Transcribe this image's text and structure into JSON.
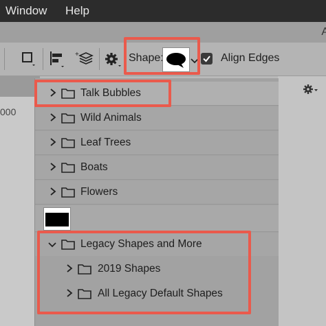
{
  "menubar": {
    "items": [
      "Window",
      "Help"
    ]
  },
  "strip_char": "A",
  "options_bar": {
    "shape_label": "Shape:",
    "align_edges_label": "Align Edges",
    "align_edges_checked": true
  },
  "ruler_label": "000",
  "dropdown": {
    "groups": [
      {
        "label": "Talk Bubbles"
      },
      {
        "label": "Wild Animals"
      },
      {
        "label": "Leaf Trees"
      },
      {
        "label": "Boats"
      },
      {
        "label": "Flowers"
      }
    ],
    "legacy": {
      "label": "Legacy Shapes and More",
      "children": [
        {
          "label": "2019 Shapes"
        },
        {
          "label": "All Legacy Default Shapes"
        }
      ]
    }
  },
  "colors": {
    "highlight": "#ea5a4c",
    "menubar": "#2c2c2c"
  }
}
